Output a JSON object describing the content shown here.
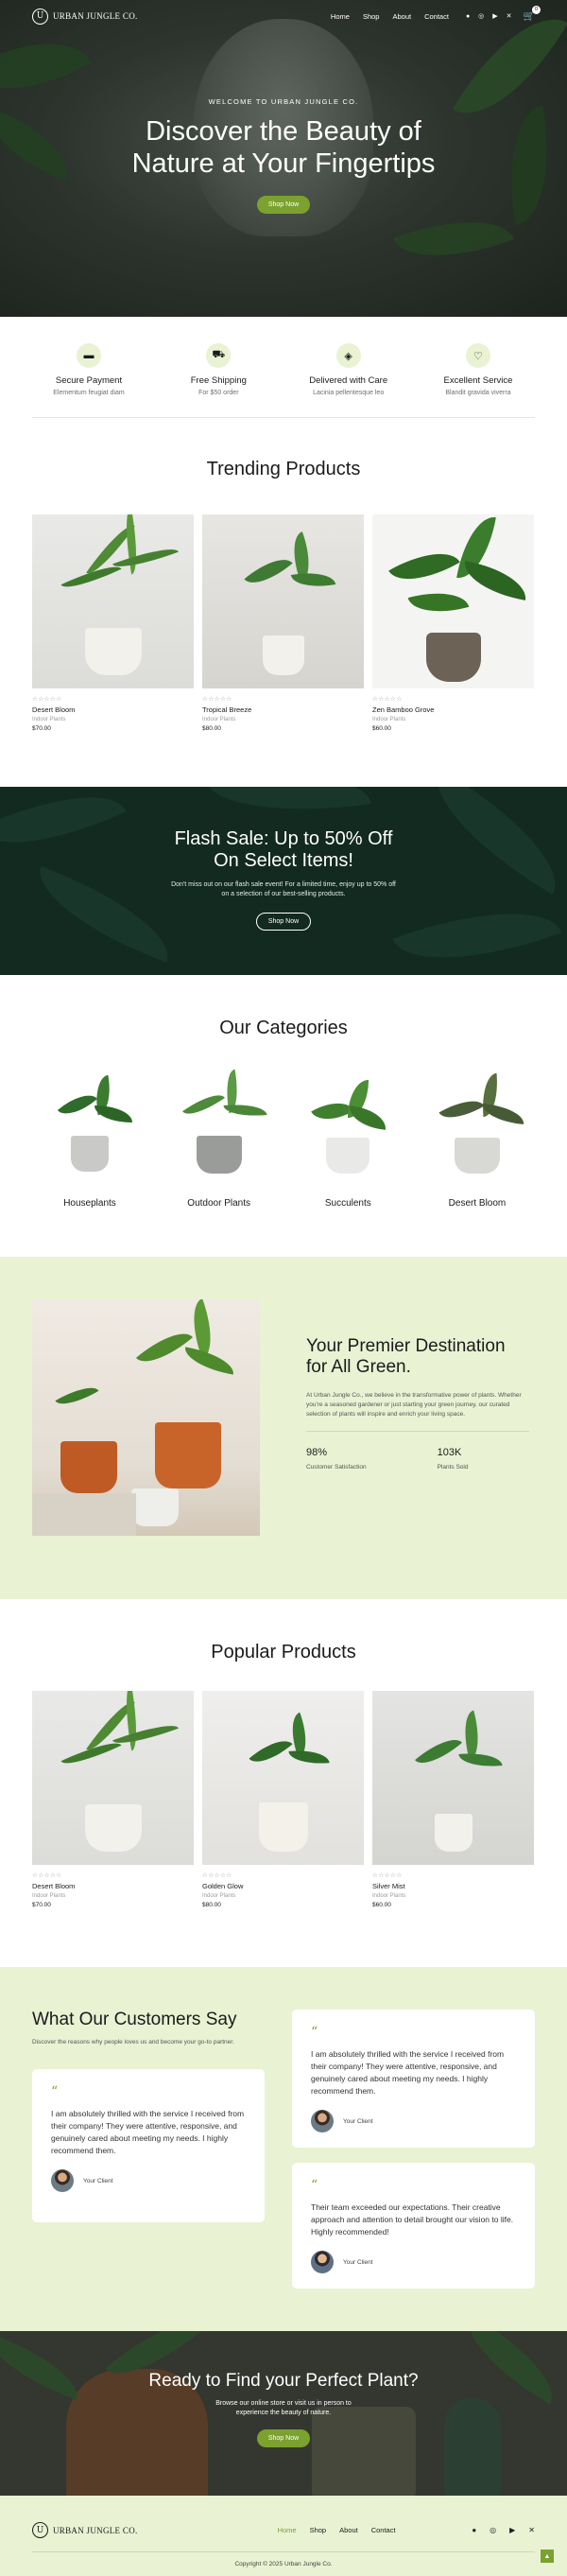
{
  "brand": {
    "logo_mark": "U",
    "name": "URBAN JUNGLE CO."
  },
  "nav": {
    "links": [
      "Home",
      "Shop",
      "About",
      "Contact"
    ],
    "cart_count": "0"
  },
  "hero": {
    "eyebrow": "WELCOME TO URBAN JUNGLE CO.",
    "title": "Discover the Beauty of Nature at Your Fingertips",
    "button": "Shop Now"
  },
  "features": [
    {
      "icon": "card-icon",
      "title": "Secure Payment",
      "sub": "Elementum feugiat diam"
    },
    {
      "icon": "truck-icon",
      "title": "Free Shipping",
      "sub": "For $50 order"
    },
    {
      "icon": "box-icon",
      "title": "Delivered with Care",
      "sub": "Lacinia pellentesque leo"
    },
    {
      "icon": "heart-icon",
      "title": "Excellent Service",
      "sub": "Blandit gravida viverra"
    }
  ],
  "trending": {
    "title": "Trending Products",
    "items": [
      {
        "stars": "☆☆☆☆☆",
        "name": "Desert Bloom",
        "category": "Indoor Plants",
        "price": "$70.00"
      },
      {
        "stars": "☆☆☆☆☆",
        "name": "Tropical Breeze",
        "category": "Indoor Plants",
        "price": "$80.00"
      },
      {
        "stars": "☆☆☆☆☆",
        "name": "Zen Bamboo Grove",
        "category": "Indoor Plants",
        "price": "$60.00"
      }
    ]
  },
  "flash": {
    "title": "Flash Sale: Up to 50% Off On Select Items!",
    "text": "Don't miss out on our flash sale event! For a limited time, enjoy up to 50% off on a selection of our best-selling products.",
    "button": "Shop Now"
  },
  "categories": {
    "title": "Our Categories",
    "items": [
      "Houseplants",
      "Outdoor Plants",
      "Succulents",
      "Desert Bloom"
    ]
  },
  "about": {
    "title": "Your Premier Destination for All Green.",
    "body": "At Urban Jungle Co., we believe in the transformative power of plants. Whether you're a seasoned gardener or just starting your green journey, our curated selection of plants will inspire and enrich your living space.",
    "stats": [
      {
        "value": "98%",
        "label": "Customer Satisfaction"
      },
      {
        "value": "103K",
        "label": "Plants Sold"
      }
    ]
  },
  "popular": {
    "title": "Popular Products",
    "items": [
      {
        "stars": "☆☆☆☆☆",
        "name": "Desert Bloom",
        "category": "Indoor Plants",
        "price": "$70.00"
      },
      {
        "stars": "☆☆☆☆☆",
        "name": "Golden Glow",
        "category": "Indoor Plants",
        "price": "$80.00"
      },
      {
        "stars": "☆☆☆☆☆",
        "name": "Silver Mist",
        "category": "Indoor Plants",
        "price": "$60.00"
      }
    ]
  },
  "testimonials": {
    "title": "What Our Customers Say",
    "subtitle": "Discover the reasons why people loves us and become your go-to partner.",
    "quote_mark": "“",
    "cards": [
      {
        "text": "I am absolutely thrilled with the service I received from their company! They were attentive, responsive, and genuinely cared about meeting my needs. I highly recommend them.",
        "client": "Your Client"
      },
      {
        "text": "I am absolutely thrilled with the service I received from their company! They were attentive, responsive, and genuinely cared about meeting my needs. I highly recommend them.",
        "client": "Your Client"
      },
      {
        "text": "Their team exceeded our expectations. Their creative approach and attention to detail brought our vision to life. Highly recommended!",
        "client": "Your Client"
      }
    ]
  },
  "cta": {
    "title": "Ready to Find your Perfect Plant?",
    "text": "Browse our online store or visit us in person to experience the beauty of nature.",
    "button": "Shop Now"
  },
  "footer": {
    "links": [
      "Home",
      "Shop",
      "About",
      "Contact"
    ],
    "copyright": "Copyright © 2025 Urban Jungle Co."
  },
  "colors": {
    "accent": "#7ba12f",
    "light_green": "#e9f2d3",
    "dark_green": "#173329"
  }
}
